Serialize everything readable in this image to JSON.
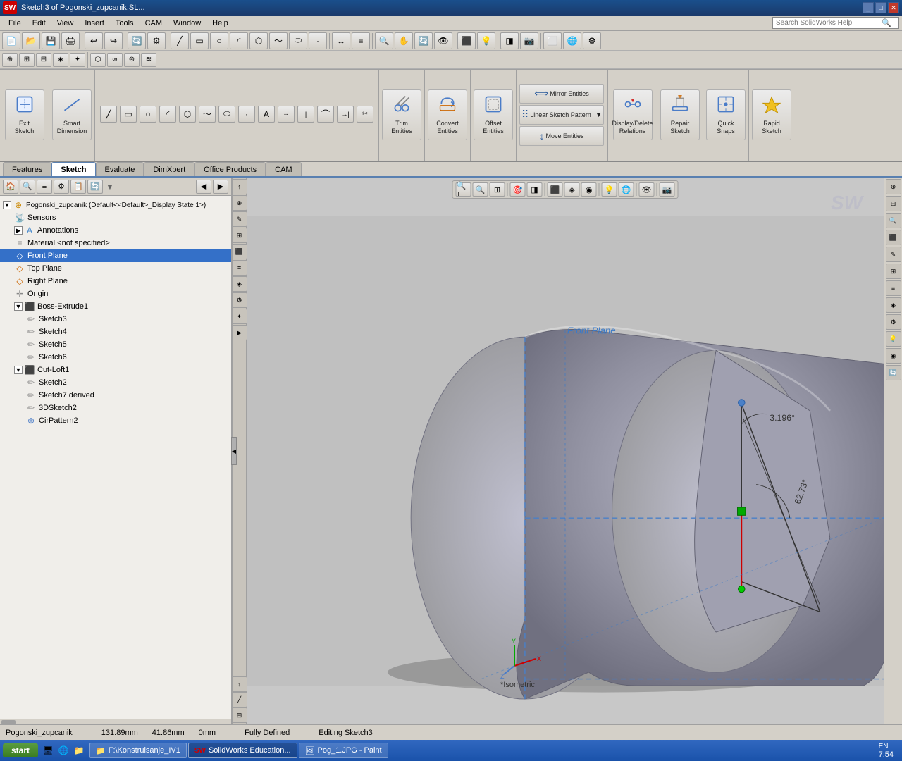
{
  "app": {
    "title": "Sketch3 of Pogonski_zupcanik.SL...",
    "logo": "SW"
  },
  "menubar": {
    "items": [
      "File",
      "Edit",
      "View",
      "Insert",
      "Tools",
      "CAM",
      "Window",
      "Help"
    ],
    "search_placeholder": "Search SolidWorks Help"
  },
  "tabs": {
    "items": [
      "Features",
      "Sketch",
      "Evaluate",
      "DimXpert",
      "Office Products",
      "CAM"
    ],
    "active": "Sketch"
  },
  "ribbon": {
    "groups": [
      {
        "name": "exit-sketch-group",
        "tools_large": [
          {
            "id": "exit-sketch",
            "icon": "⬛",
            "label": "Exit\nSketch"
          },
          {
            "id": "smart-dimension",
            "icon": "↔",
            "label": "Smart\nDimension"
          }
        ]
      },
      {
        "name": "draw-group",
        "tools": []
      },
      {
        "name": "trim-group",
        "tools_large": [
          {
            "id": "trim-entities",
            "icon": "✂",
            "label": "Trim\nEntities"
          }
        ]
      },
      {
        "name": "convert-group",
        "tools_large": [
          {
            "id": "convert-entities",
            "icon": "↩",
            "label": "Convert\nEntities"
          }
        ]
      },
      {
        "name": "offset-group",
        "tools_large": [
          {
            "id": "offset-entities",
            "icon": "⬜",
            "label": "Offset\nEntities"
          }
        ]
      },
      {
        "name": "mirror-group",
        "tools_stacked": [
          {
            "id": "mirror-entities",
            "icon": "⟺",
            "label": "Mirror Entities"
          },
          {
            "id": "linear-sketch-pattern",
            "icon": "⠿",
            "label": "Linear Sketch Pattern"
          },
          {
            "id": "move-entities",
            "icon": "↕",
            "label": "Move Entities"
          }
        ]
      },
      {
        "name": "display-relations-group",
        "tools_large": [
          {
            "id": "display-delete-relations",
            "icon": "≠",
            "label": "Display/Delete\nRelations"
          }
        ]
      },
      {
        "name": "repair-group",
        "tools_large": [
          {
            "id": "repair-sketch",
            "icon": "🔧",
            "label": "Repair\nSketch"
          }
        ]
      },
      {
        "name": "quick-snaps-group",
        "tools_large": [
          {
            "id": "quick-snaps",
            "icon": "🔲",
            "label": "Quick\nSnaps"
          }
        ]
      },
      {
        "name": "rapid-sketch-group",
        "tools_large": [
          {
            "id": "rapid-sketch",
            "icon": "⚡",
            "label": "Rapid\nSketch"
          }
        ]
      }
    ]
  },
  "left_panel": {
    "toolbar_buttons": [
      "🏠",
      "🔍",
      "≡",
      "⚙",
      "📋",
      "🔄",
      "▼"
    ],
    "filter_icon": "▼",
    "tree": {
      "root": {
        "label": "Pogonski_zupcanik (Default<<Default>_Display State 1>)",
        "expanded": true,
        "children": [
          {
            "label": "Sensors",
            "icon": "📡",
            "indent": 1
          },
          {
            "label": "Annotations",
            "icon": "A",
            "indent": 1,
            "expanded": false
          },
          {
            "label": "Material <not specified>",
            "icon": "≡",
            "indent": 1
          },
          {
            "label": "Front Plane",
            "icon": "◇",
            "indent": 1,
            "selected": true
          },
          {
            "label": "Top Plane",
            "icon": "◇",
            "indent": 1
          },
          {
            "label": "Right Plane",
            "icon": "◇",
            "indent": 1
          },
          {
            "label": "Origin",
            "icon": "✛",
            "indent": 1
          },
          {
            "label": "Boss-Extrude1",
            "icon": "⬛",
            "indent": 1,
            "expanded": true,
            "children": [
              {
                "label": "Sketch3",
                "icon": "✏",
                "indent": 2
              },
              {
                "label": "Sketch4",
                "icon": "✏",
                "indent": 2
              },
              {
                "label": "Sketch5",
                "icon": "✏",
                "indent": 2
              },
              {
                "label": "Sketch6",
                "icon": "✏",
                "indent": 2
              }
            ]
          },
          {
            "label": "Cut-Loft1",
            "icon": "⬛",
            "indent": 1,
            "expanded": true,
            "children": [
              {
                "label": "Sketch2",
                "icon": "✏",
                "indent": 2
              },
              {
                "label": "Sketch7 derived",
                "icon": "✏",
                "indent": 2
              },
              {
                "label": "3DSketch2",
                "icon": "✏",
                "indent": 2
              }
            ]
          },
          {
            "label": "CirPattern2",
            "icon": "⊕",
            "indent": 2
          }
        ]
      }
    }
  },
  "viewport": {
    "view_buttons": [
      "🔍+",
      "🔍-",
      "🔎",
      "⬛",
      "🎯",
      "🔄",
      "◨",
      "⬜",
      "💡",
      "🖊"
    ],
    "plane_label": "Front Plane",
    "view_label": "*Isometric",
    "dimensions": {
      "angle1": "3.196°",
      "length1": "62.73°"
    }
  },
  "statusbar": {
    "model_name": "Pogonski_zupcanik",
    "coords": {
      "x": "131.89mm",
      "y": "41.86mm",
      "z": "0mm"
    },
    "status": "Fully Defined",
    "edit_info": "Editing Sketch3"
  },
  "taskbar": {
    "start_label": "start",
    "items": [
      {
        "label": "F:\\Konstruisanje_IV1",
        "icon": "📁"
      },
      {
        "label": "SolidWorks Education...",
        "icon": "SW",
        "active": true
      },
      {
        "label": "Pog_1.JPG - Paint",
        "icon": "🖼"
      }
    ],
    "clock": "7:54",
    "lang": "EN"
  }
}
